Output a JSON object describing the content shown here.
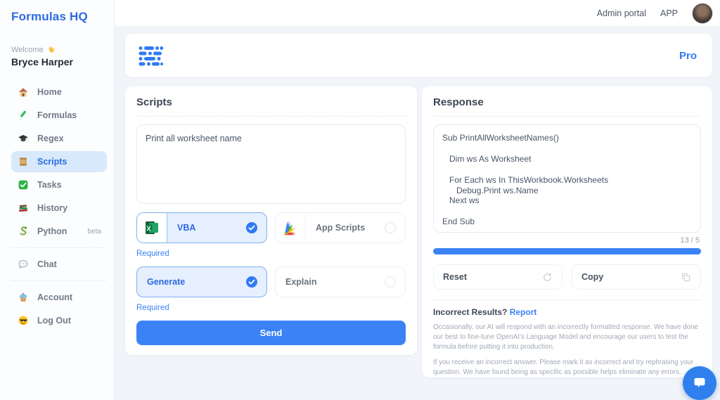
{
  "brand": {
    "title": "Formulas HQ"
  },
  "topbar": {
    "admin_portal": "Admin portal",
    "app": "APP"
  },
  "sidebar": {
    "welcome": "Welcome",
    "user_name": "Bryce Harper",
    "items": [
      {
        "label": "Home",
        "icon": "home-icon"
      },
      {
        "label": "Formulas",
        "icon": "pen-icon"
      },
      {
        "label": "Regex",
        "icon": "graduation-cap-icon"
      },
      {
        "label": "Scripts",
        "icon": "scroll-icon",
        "active": true
      },
      {
        "label": "Tasks",
        "icon": "check-icon"
      },
      {
        "label": "History",
        "icon": "books-icon"
      },
      {
        "label": "Python",
        "icon": "snake-icon",
        "badge": "beta"
      },
      {
        "label": "Chat",
        "icon": "chat-bubble-icon"
      },
      {
        "label": "Account",
        "icon": "cupcake-icon"
      },
      {
        "label": "Log Out",
        "icon": "sunglasses-icon"
      }
    ]
  },
  "header": {
    "plan_label": "Pro"
  },
  "scripts_panel": {
    "title": "Scripts",
    "prompt_value": "Print all worksheet name",
    "language_options": [
      {
        "label": "VBA",
        "selected": true,
        "icon": "excel-icon"
      },
      {
        "label": "App Scripts",
        "selected": false,
        "icon": "apps-script-icon"
      }
    ],
    "required_label": "Required",
    "action_options": [
      {
        "label": "Generate",
        "selected": true
      },
      {
        "label": "Explain",
        "selected": false
      }
    ],
    "send_label": "Send"
  },
  "response_panel": {
    "title": "Response",
    "code": "Sub PrintAllWorksheetNames()\n\n   Dim ws As Worksheet\n\n   For Each ws In ThisWorkbook.Worksheets\n      Debug.Print ws.Name\n   Next ws\n\nEnd Sub",
    "usage_counter": "13 / 5",
    "reset_label": "Reset",
    "copy_label": "Copy",
    "incorrect_label": "Incorrect Results?",
    "report_label": "Report",
    "disclaimer_1": "Occasionally, our AI will respond with an incorrectly formatted response. We have done our best to fine-tune OpenAI's  Language Model and encourage our users to test the formula before putting it into production.",
    "disclaimer_2": "If you receive an incorrect answer. Please mark it as incorrect and try rephrasing your question. We have found being as specific as possible helps eliminate any errors."
  },
  "colors": {
    "primary": "#3b82f6",
    "brand_blue": "#2b6be4",
    "selected_bg": "#e5effd"
  }
}
